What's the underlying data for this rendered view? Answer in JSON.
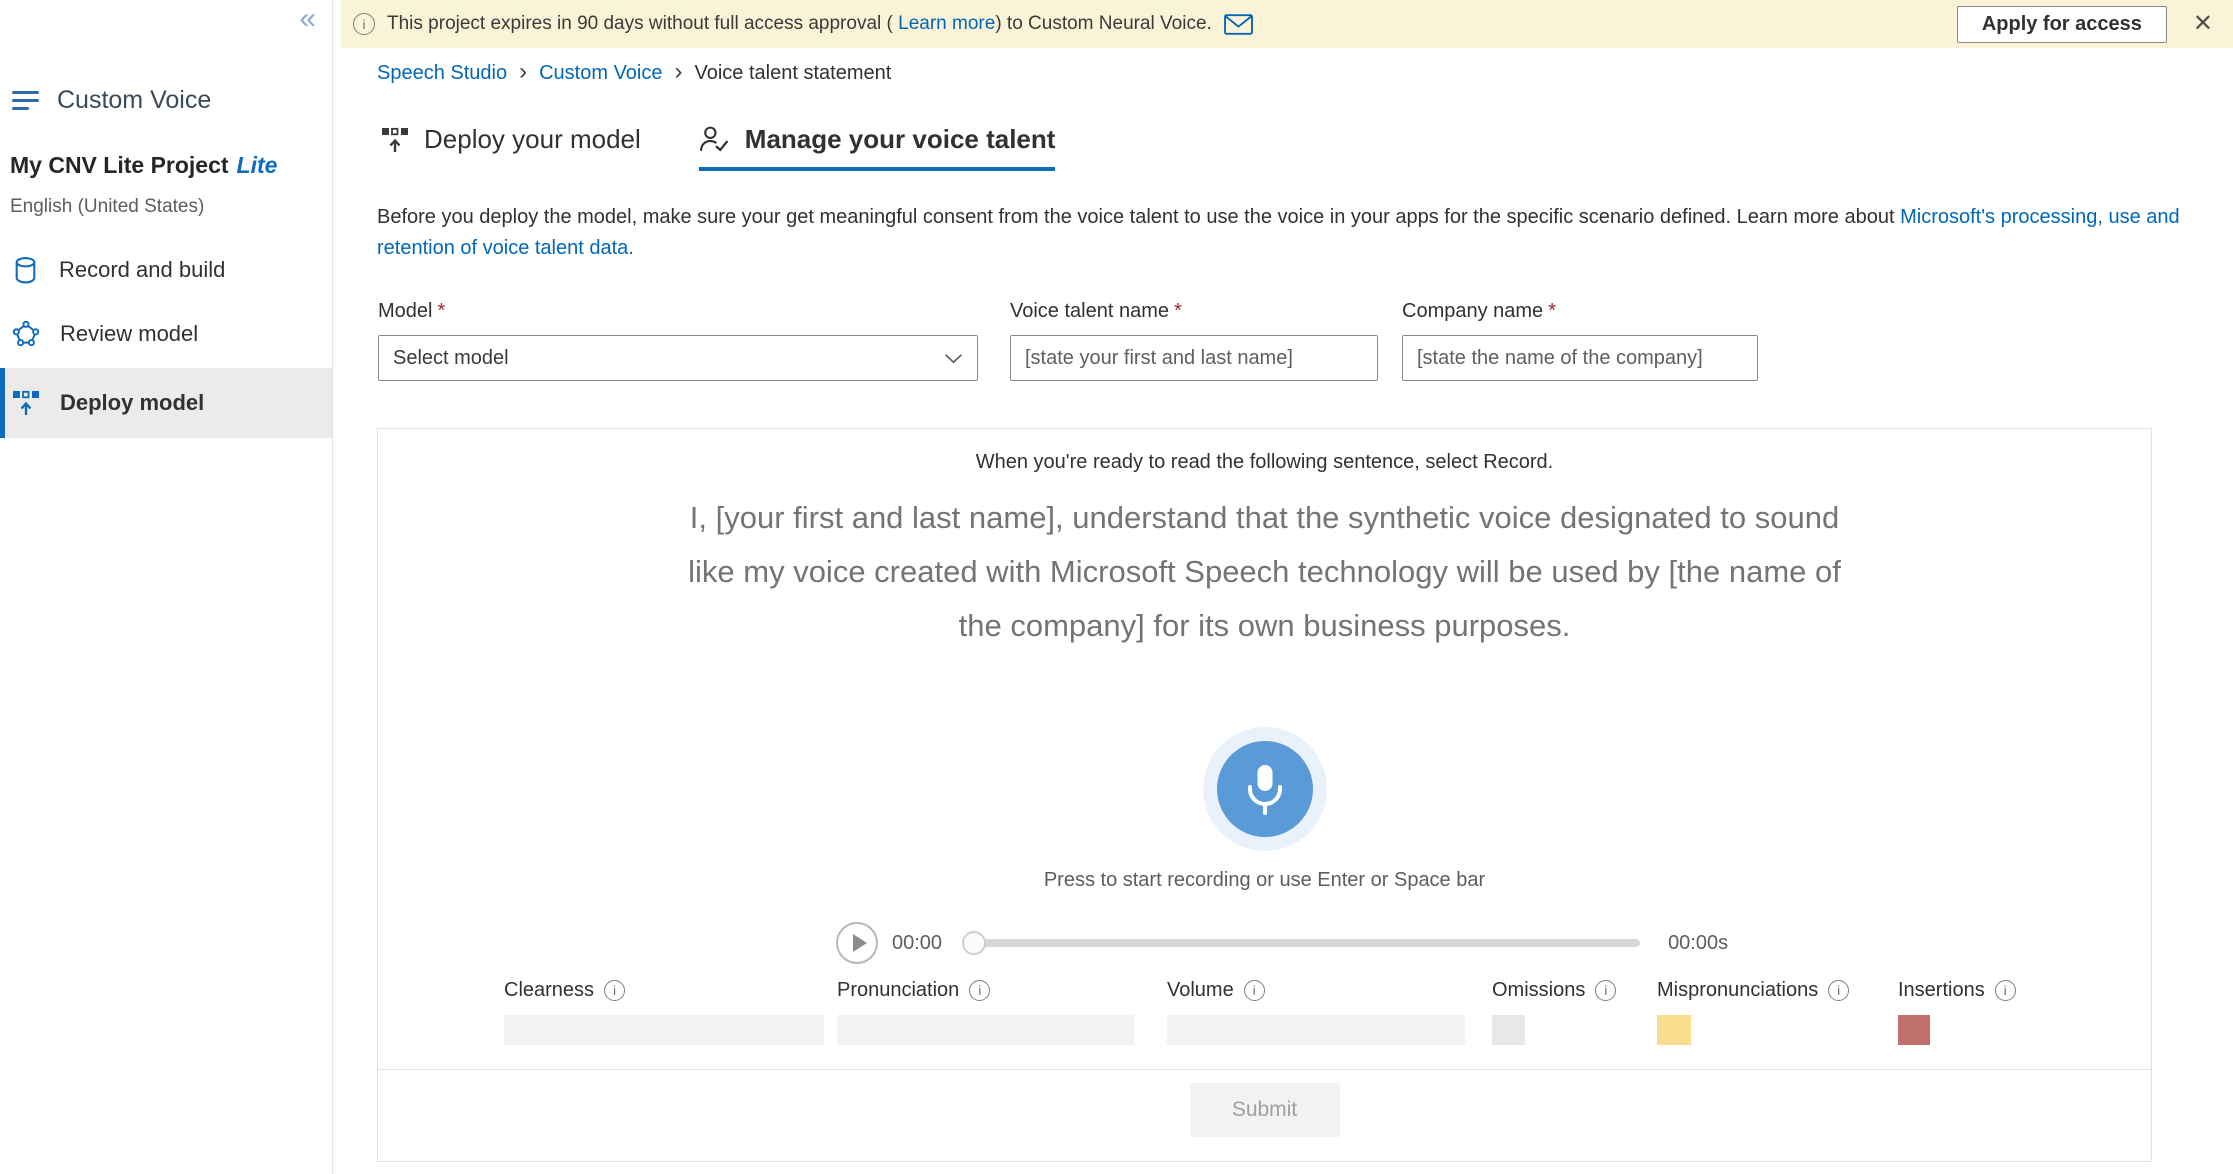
{
  "icons": {
    "info_glyph": "i",
    "close_glyph": "✕",
    "collapse_glyph": "«",
    "breadcrumb_separator": "›"
  },
  "banner": {
    "text_before_link": "This project expires in 90 days without full access approval ( ",
    "link_label": "Learn more",
    "text_after_link": ") to Custom Neural Voice.",
    "apply_button": "Apply for access"
  },
  "sidebar": {
    "title": "Custom Voice",
    "project": {
      "name": "My CNV Lite Project",
      "badge": "Lite",
      "language": "English (United States)"
    },
    "nav": [
      {
        "label": "Record and build",
        "icon": "database-icon",
        "selected": false
      },
      {
        "label": "Review model",
        "icon": "model-network-icon",
        "selected": false
      },
      {
        "label": "Deploy model",
        "icon": "deploy-icon",
        "selected": true
      }
    ]
  },
  "breadcrumb": {
    "items": [
      "Speech Studio",
      "Custom Voice",
      "Voice talent statement"
    ]
  },
  "tabs": [
    {
      "label": "Deploy your model",
      "active": false
    },
    {
      "label": "Manage your voice talent",
      "active": true
    }
  ],
  "description": {
    "text": "Before you deploy the model, make sure your get meaningful consent from the voice talent to use the voice in your apps for the specific scenario defined. Learn more about ",
    "link": "Microsoft's processing, use and retention of voice talent data."
  },
  "form": {
    "required_mark": "*",
    "model": {
      "label": "Model",
      "value": "Select model"
    },
    "voice_talent_name": {
      "label": "Voice talent name",
      "placeholder": "[state your first and last name]"
    },
    "company_name": {
      "label": "Company name",
      "placeholder": "[state the name of the company]"
    }
  },
  "recorder": {
    "instruction": "When you're ready to read the following sentence, select Record.",
    "statement": "I, [your first and last name], understand that the synthetic voice designated to sound like my voice created with Microsoft Speech technology will be used by [the name of the company] for its own business purposes.",
    "press_hint": "Press to start recording or use Enter or Space bar",
    "player": {
      "current_time": "00:00",
      "duration": "00:00s"
    },
    "metrics": [
      {
        "label": "Clearness",
        "type": "bar",
        "color": "#f3f2f1"
      },
      {
        "label": "Pronunciation",
        "type": "bar",
        "color": "#f3f2f1"
      },
      {
        "label": "Volume",
        "type": "bar",
        "color": "#f3f2f1"
      },
      {
        "label": "Omissions",
        "type": "square",
        "color": "#e9e8e8"
      },
      {
        "label": "Mispronunciations",
        "type": "square",
        "color": "#f8dd8f"
      },
      {
        "label": "Insertions",
        "type": "square",
        "color": "#c1716d"
      }
    ],
    "submit_button": "Submit"
  },
  "colors": {
    "accent": "#0f6cbd",
    "link": "#0067b8",
    "banner_bg": "#fbf3d7",
    "mic_button": "#5a9ad6",
    "mic_halo": "#e9f1fb",
    "required": "#a4262c",
    "selected_nav_bg": "#edebe9"
  }
}
